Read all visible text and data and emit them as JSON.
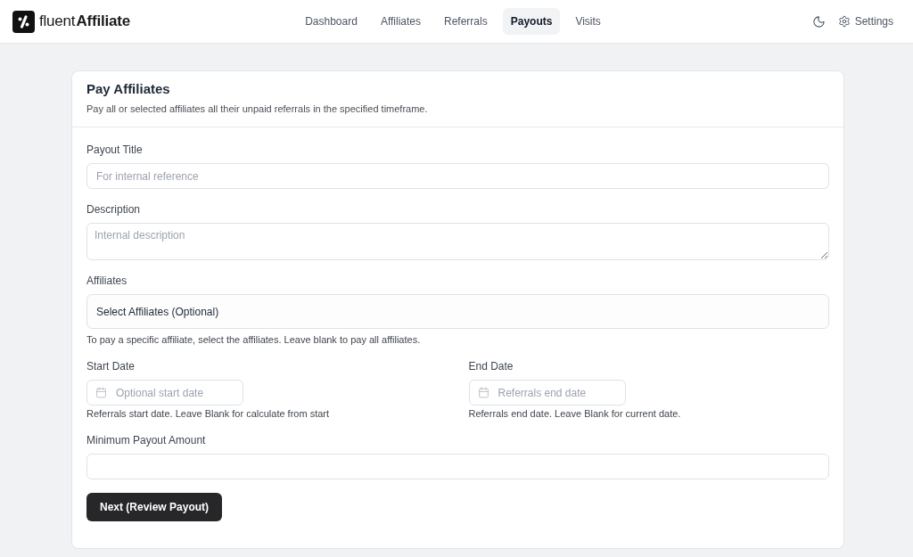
{
  "header": {
    "logo_text": "fluent**Affiliate**",
    "nav": [
      {
        "label": "Dashboard",
        "selected": false
      },
      {
        "label": "Affiliates",
        "selected": false
      },
      {
        "label": "Referrals",
        "selected": false
      },
      {
        "label": "Payouts",
        "selected": true
      },
      {
        "label": "Visits",
        "selected": false
      }
    ],
    "settings_label": "Settings"
  },
  "card": {
    "title": "Pay Affiliates",
    "subtitle": "Pay all or selected affiliates all their unpaid referrals in the specified timeframe.",
    "fields": [
      {
        "kind": "text",
        "label": "Payout Title",
        "placeholder": "For internal reference"
      },
      {
        "kind": "textarea",
        "label": "Description",
        "placeholder": "Internal description"
      },
      {
        "kind": "select",
        "label": "Affiliates",
        "placeholder": "Select Affiliates (Optional)",
        "help": "To pay a specific affiliate, select the affiliates. Leave blank to pay all affiliates."
      },
      {
        "kind": "date_pair",
        "items": [
          {
            "label": "Start Date",
            "placeholder": "Optional start date",
            "help": "Referrals start date. Leave Blank for calculate from start"
          },
          {
            "label": "End Date",
            "placeholder": "Referrals end date",
            "help": "Referrals end date. Leave Blank for current date."
          }
        ]
      },
      {
        "kind": "text",
        "label": "Minimum Payout Amount"
      }
    ],
    "submit_button": "Next (Review Payout)"
  }
}
